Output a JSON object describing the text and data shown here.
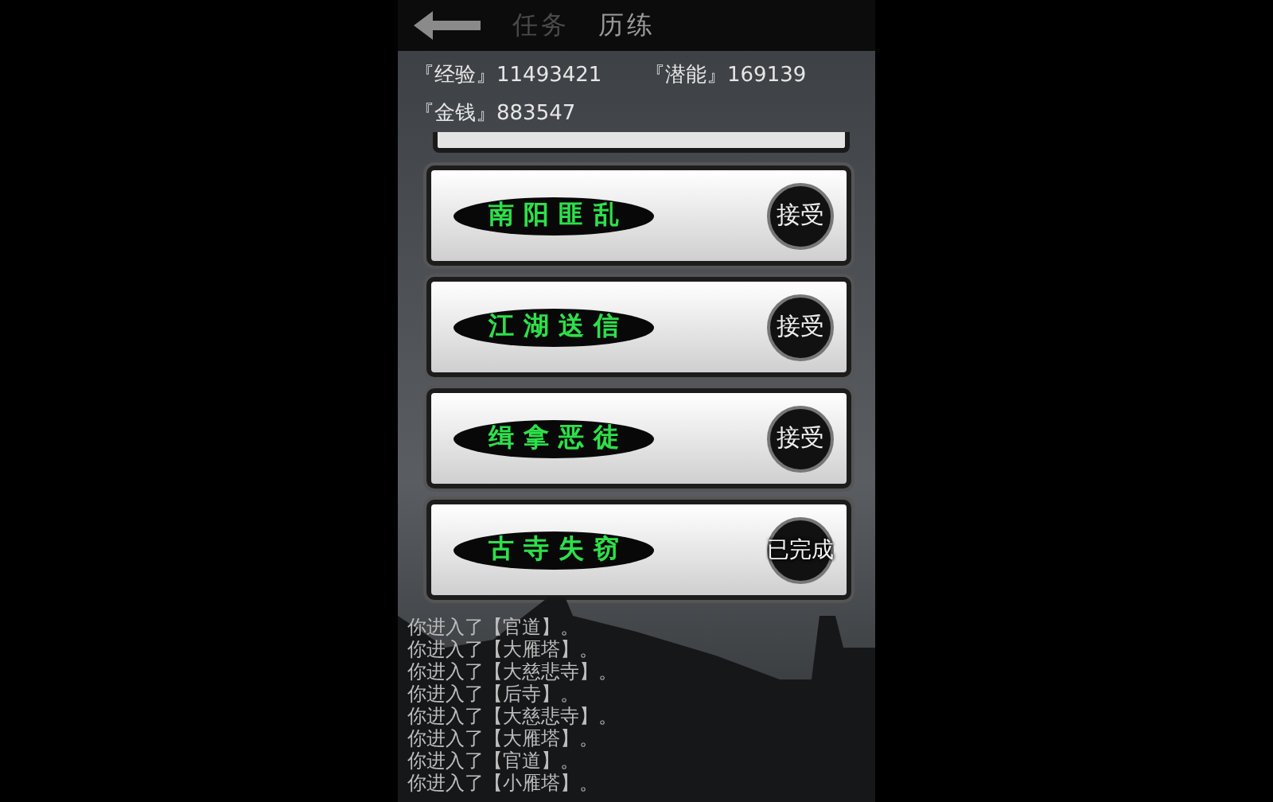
{
  "header": {
    "tabs": [
      {
        "label": "任务",
        "selected": false
      },
      {
        "label": "历练",
        "selected": true
      }
    ]
  },
  "stats": [
    {
      "label": "『经验』",
      "value": "11493421"
    },
    {
      "label": "『潜能』",
      "value": "169139"
    },
    {
      "label": "『金钱』",
      "value": "883547"
    }
  ],
  "quests": [
    {
      "name": "南阳匪乱",
      "action": "接受",
      "kind": "accept"
    },
    {
      "name": "江湖送信",
      "action": "接受",
      "kind": "accept"
    },
    {
      "name": "缉拿恶徒",
      "action": "接受",
      "kind": "accept"
    },
    {
      "name": "古寺失窃",
      "action": "已完成",
      "kind": "done"
    }
  ],
  "log": [
    "你进入了【官道】。",
    "你进入了【大雁塔】。",
    "你进入了【大慈悲寺】。",
    "你进入了【后寺】。",
    "你进入了【大慈悲寺】。",
    "你进入了【大雁塔】。",
    "你进入了【官道】。",
    "你进入了【小雁塔】。"
  ]
}
